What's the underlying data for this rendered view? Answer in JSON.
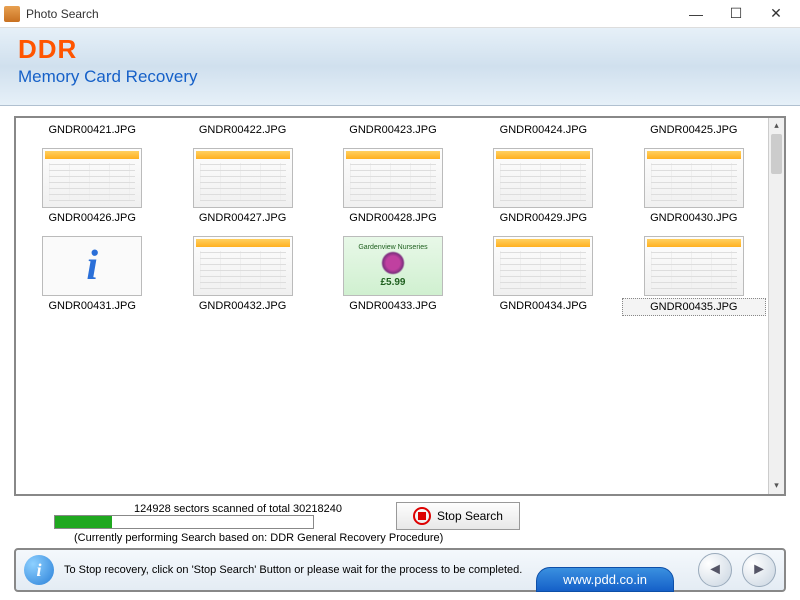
{
  "window": {
    "title": "Photo Search"
  },
  "header": {
    "logo": "DDR",
    "subtitle": "Memory Card Recovery"
  },
  "files": [
    {
      "name": "GNDR00421.JPG",
      "kind": "label"
    },
    {
      "name": "GNDR00422.JPG",
      "kind": "label"
    },
    {
      "name": "GNDR00423.JPG",
      "kind": "label"
    },
    {
      "name": "GNDR00424.JPG",
      "kind": "label"
    },
    {
      "name": "GNDR00425.JPG",
      "kind": "label"
    },
    {
      "name": "GNDR00426.JPG",
      "kind": "app"
    },
    {
      "name": "GNDR00427.JPG",
      "kind": "app"
    },
    {
      "name": "GNDR00428.JPG",
      "kind": "app"
    },
    {
      "name": "GNDR00429.JPG",
      "kind": "app"
    },
    {
      "name": "GNDR00430.JPG",
      "kind": "app"
    },
    {
      "name": "GNDR00431.JPG",
      "kind": "info"
    },
    {
      "name": "GNDR00432.JPG",
      "kind": "app"
    },
    {
      "name": "GNDR00433.JPG",
      "kind": "promo",
      "promo_title": "Gardenview Nurseries",
      "promo_price": "£5.99"
    },
    {
      "name": "GNDR00434.JPG",
      "kind": "app"
    },
    {
      "name": "GNDR00435.JPG",
      "kind": "app",
      "selected": true
    }
  ],
  "progress": {
    "status": "124928 sectors scanned of total 30218240",
    "note": "(Currently performing Search based on:  DDR General Recovery Procedure)",
    "percent": 22
  },
  "buttons": {
    "stop": "Stop Search"
  },
  "footer": {
    "hint": "To Stop recovery, click on 'Stop Search' Button or please wait for the process to be completed.",
    "url": "www.pdd.co.in"
  }
}
